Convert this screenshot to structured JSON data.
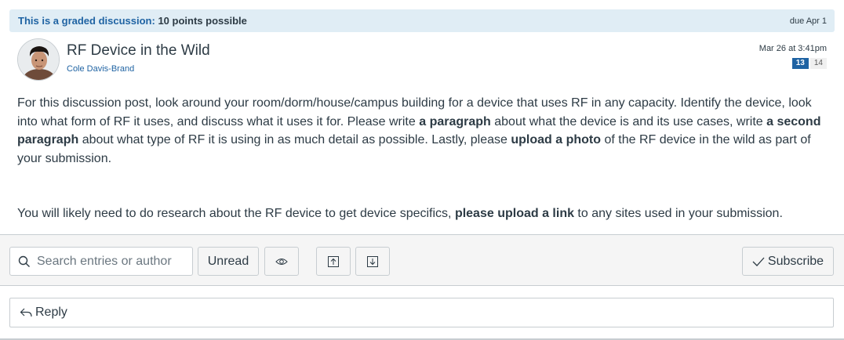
{
  "banner": {
    "graded_label": "This is a graded discussion:",
    "points": "10 points possible",
    "due": "due Apr 1"
  },
  "post": {
    "title": "RF Device in the Wild",
    "author": "Cole Davis-Brand",
    "date": "Mar 26 at 3:41pm",
    "unread_count": "13",
    "total_count": "14",
    "paragraph1": [
      {
        "text": "For this discussion post, look around your room/dorm/house/campus building for a device that uses RF in any capacity. Identify the device, look into what form of RF it uses, and discuss what it uses it for. Please write "
      },
      {
        "text": "a paragraph",
        "bold": true
      },
      {
        "text": " about what the device is and its use cases, write "
      },
      {
        "text": "a second paragraph",
        "bold": true
      },
      {
        "text": " about what type of RF it is using in as much detail as possible. Lastly, please "
      },
      {
        "text": "upload a photo",
        "bold": true
      },
      {
        "text": " of the RF device in the wild as part of your submission."
      }
    ],
    "paragraph2": [
      {
        "text": "You will likely need to do research about the RF device to get device specifics, "
      },
      {
        "text": "please upload a link",
        "bold": true
      },
      {
        "text": " to any sites used in your submission."
      }
    ]
  },
  "toolbar": {
    "search_placeholder": "Search entries or author",
    "unread_label": "Unread",
    "subscribe_label": "Subscribe"
  },
  "reply": {
    "label": "Reply"
  },
  "icons": {
    "search": "search-icon",
    "eye": "eye-icon",
    "upload": "upload-icon",
    "download": "download-icon",
    "check": "check-icon",
    "reply": "reply-icon"
  },
  "colors": {
    "link": "#1f63a3",
    "banner_bg": "#e0edf5",
    "text": "#2d3b45"
  }
}
